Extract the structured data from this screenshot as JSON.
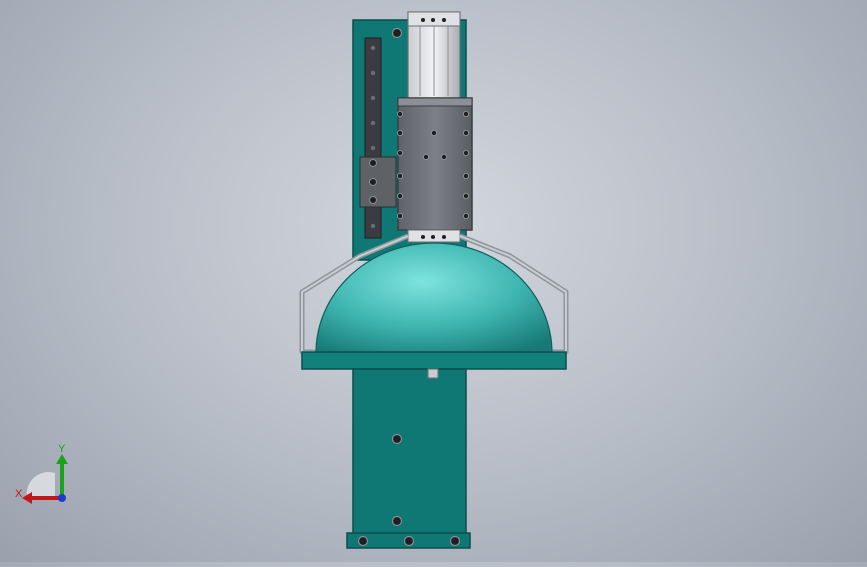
{
  "viewport": {
    "colors": {
      "plate": "#0f7874",
      "plate_edge": "#0a4f4c",
      "dome_light": "#7ee3de",
      "dome_mid": "#3fb5b0",
      "dome_dark": "#187a77",
      "rail": "#3a3c40",
      "carriage": "#6f7378",
      "carriage_edge": "#3a3d41",
      "bracket": "#8f959c",
      "bolt": "#1d1f22"
    }
  },
  "triad": {
    "x_label": "X",
    "y_label": "Y",
    "colors": {
      "x": "#c01818",
      "y": "#1aa31a",
      "z": "#1a3ad0"
    }
  }
}
